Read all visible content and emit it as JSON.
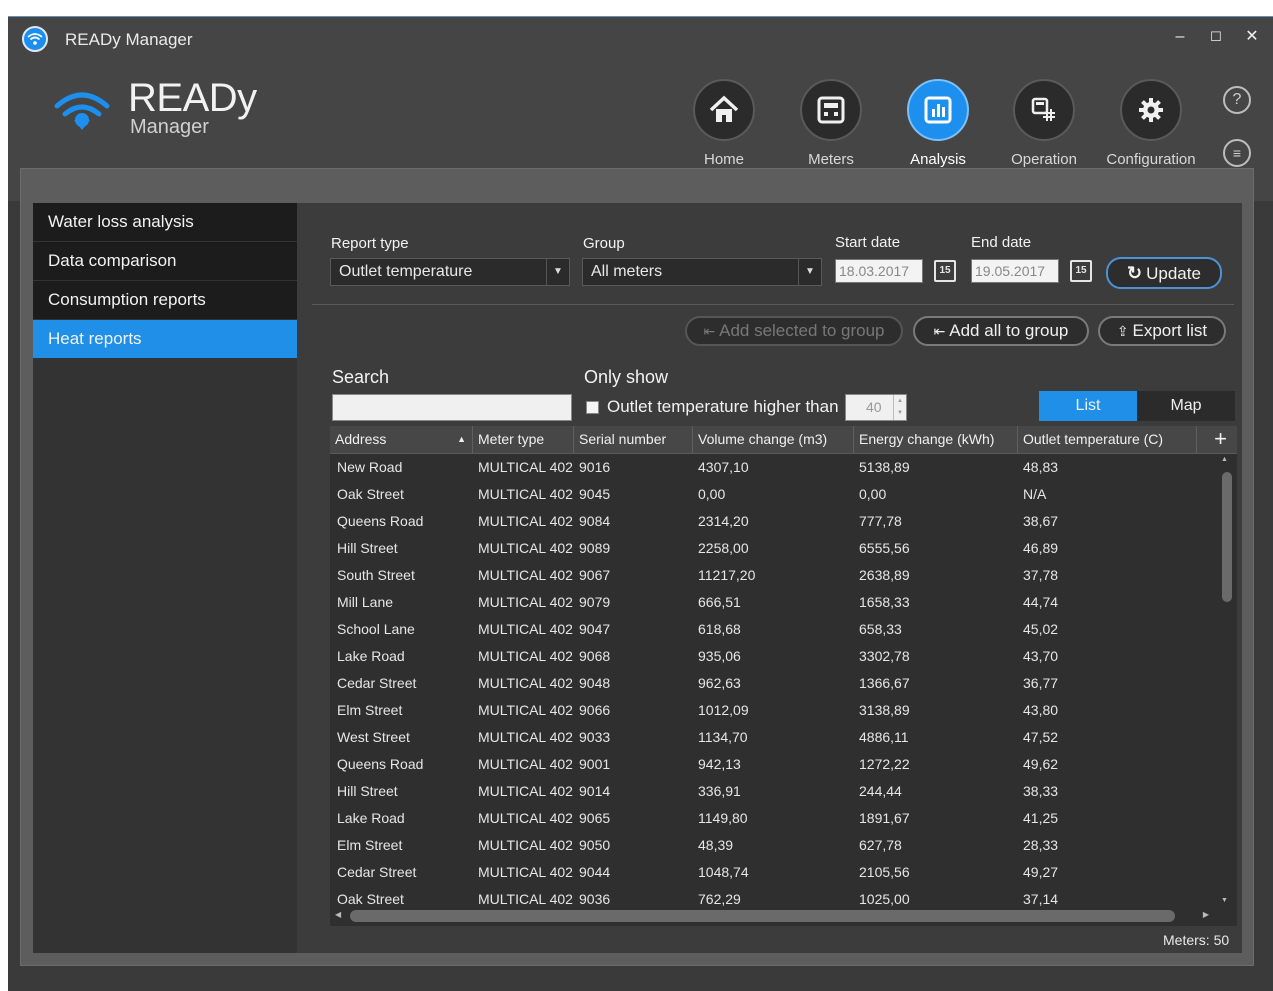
{
  "window": {
    "title": "READy Manager",
    "minimize": "–",
    "maximize": "☐",
    "close": "✕"
  },
  "logo": {
    "name": "READy",
    "sub": "Manager"
  },
  "nav": [
    {
      "label": "Home",
      "icon": "home-icon"
    },
    {
      "label": "Meters",
      "icon": "meter-icon"
    },
    {
      "label": "Analysis",
      "icon": "chart-icon",
      "active": true
    },
    {
      "label": "Operation",
      "icon": "operation-icon"
    },
    {
      "label": "Configuration",
      "icon": "gear-icon"
    }
  ],
  "help": {
    "help_glyph": "?",
    "menu_glyph": "≡"
  },
  "sidebar": {
    "items": [
      {
        "label": "Water loss analysis"
      },
      {
        "label": "Data comparison"
      },
      {
        "label": "Consumption reports"
      },
      {
        "label": "Heat reports",
        "active": true
      }
    ]
  },
  "filters": {
    "report_type_label": "Report type",
    "report_type_value": "Outlet temperature",
    "group_label": "Group",
    "group_value": "All meters",
    "start_date_label": "Start date",
    "start_date_value": "18.03.2017",
    "end_date_label": "End date",
    "end_date_value": "19.05.2017",
    "calendar_glyph": "15",
    "update_label": "Update"
  },
  "actions": {
    "add_selected_label": "Add selected to group",
    "add_all_label": "Add all to group",
    "export_label": "Export list"
  },
  "search": {
    "title": "Search",
    "value": ""
  },
  "only_show": {
    "title": "Only show",
    "checkbox_label": "Outlet temperature higher than",
    "threshold": "40"
  },
  "view_toggle": {
    "list": "List",
    "map": "Map"
  },
  "table": {
    "columns": [
      "Address",
      "Meter type",
      "Serial number",
      "Volume change (m3)",
      "Energy change (kWh)",
      "Outlet temperature (C)"
    ],
    "sort_glyph": "▲",
    "add_column_glyph": "+",
    "rows": [
      [
        "New Road",
        "MULTICAL 402",
        "9016",
        "4307,10",
        "5138,89",
        "48,83"
      ],
      [
        "Oak Street",
        "MULTICAL 402",
        "9045",
        "0,00",
        "0,00",
        "N/A"
      ],
      [
        "Queens Road",
        "MULTICAL 402",
        "9084",
        "2314,20",
        "777,78",
        "38,67"
      ],
      [
        "Hill Street",
        "MULTICAL 402",
        "9089",
        "2258,00",
        "6555,56",
        "46,89"
      ],
      [
        "South Street",
        "MULTICAL 402",
        "9067",
        "11217,20",
        "2638,89",
        "37,78"
      ],
      [
        "Mill Lane",
        "MULTICAL 402",
        "9079",
        "666,51",
        "1658,33",
        "44,74"
      ],
      [
        "School Lane",
        "MULTICAL 402",
        "9047",
        "618,68",
        "658,33",
        "45,02"
      ],
      [
        "Lake Road",
        "MULTICAL 402",
        "9068",
        "935,06",
        "3302,78",
        "43,70"
      ],
      [
        "Cedar Street",
        "MULTICAL 402",
        "9048",
        "962,63",
        "1366,67",
        "36,77"
      ],
      [
        "Elm Street",
        "MULTICAL 402",
        "9066",
        "1012,09",
        "3138,89",
        "43,80"
      ],
      [
        "West Street",
        "MULTICAL 402",
        "9033",
        "1134,70",
        "4886,11",
        "47,52"
      ],
      [
        "Queens Road",
        "MULTICAL 402",
        "9001",
        "942,13",
        "1272,22",
        "49,62"
      ],
      [
        "Hill Street",
        "MULTICAL 402",
        "9014",
        "336,91",
        "244,44",
        "38,33"
      ],
      [
        "Lake Road",
        "MULTICAL 402",
        "9065",
        "1149,80",
        "1891,67",
        "41,25"
      ],
      [
        "Elm Street",
        "MULTICAL 402",
        "9050",
        "48,39",
        "627,78",
        "28,33"
      ],
      [
        "Cedar Street",
        "MULTICAL 402",
        "9044",
        "1048,74",
        "2105,56",
        "49,27"
      ],
      [
        "Oak Street",
        "MULTICAL 402",
        "9036",
        "762,29",
        "1025,00",
        "37,14"
      ]
    ]
  },
  "footer": {
    "meters_count": "Meters: 50"
  }
}
